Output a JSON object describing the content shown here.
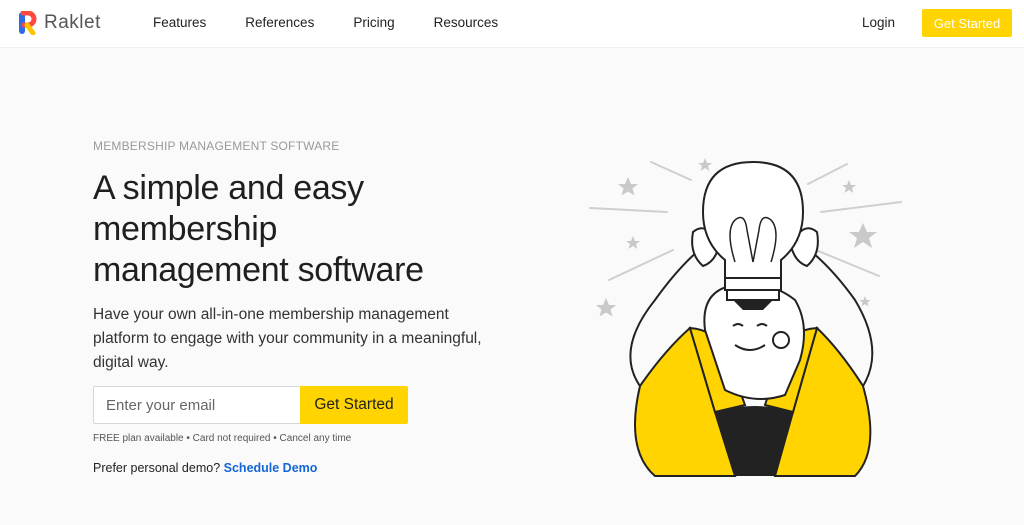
{
  "header": {
    "logo_text": "Raklet",
    "nav": [
      "Features",
      "References",
      "Pricing",
      "Resources"
    ],
    "login": "Login",
    "cta": "Get Started"
  },
  "hero": {
    "eyebrow": "MEMBERSHIP MANAGEMENT SOFTWARE",
    "headline_line1": "A simple and easy",
    "headline_line2": "membership",
    "headline_line3": "management software",
    "description": "Have your own all-in-one membership management platform to engage with your community in a meaningful, digital way.",
    "email_placeholder": "Enter your email",
    "cta": "Get Started",
    "fine_print": "FREE plan available • Card not required • Cancel any time",
    "demo_prompt": "Prefer personal demo?",
    "demo_link": "Schedule Demo"
  },
  "colors": {
    "accent": "#ffd400",
    "link": "#1466d6"
  },
  "illustration": {
    "icon": "person-holding-lightbulb-illustration"
  }
}
